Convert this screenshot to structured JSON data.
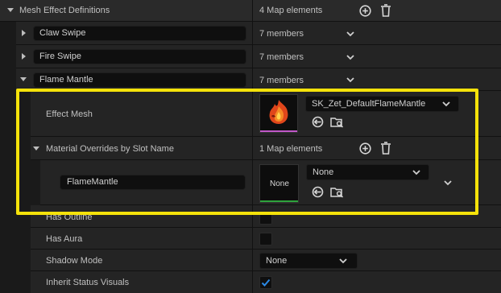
{
  "root": {
    "label": "Mesh Effect Definitions",
    "count": "4 Map elements",
    "entries": [
      {
        "key": "Claw Swipe",
        "members": "7 members"
      },
      {
        "key": "Fire Swipe",
        "members": "7 members"
      },
      {
        "key": "Flame Mantle",
        "members": "7 members"
      }
    ]
  },
  "flame": {
    "effect_mesh_label": "Effect Mesh",
    "effect_mesh_value": "SK_Zet_DefaultFlameMantle",
    "overrides_label": "Material Overrides by Slot Name",
    "overrides_count": "1 Map elements",
    "slot_key": "FlameMantle",
    "slot_thumb": "None",
    "slot_value": "None",
    "has_outline": "Has Outline",
    "has_aura": "Has Aura",
    "shadow_mode": "Shadow Mode",
    "shadow_mode_value": "None",
    "inherit_status": "Inherit Status Visuals"
  },
  "colors": {
    "highlight": "#f5e20a",
    "accent": "#2b8ae6",
    "mesh_thumb_line": "#c058c8",
    "material_thumb_line": "#2ea33c"
  }
}
